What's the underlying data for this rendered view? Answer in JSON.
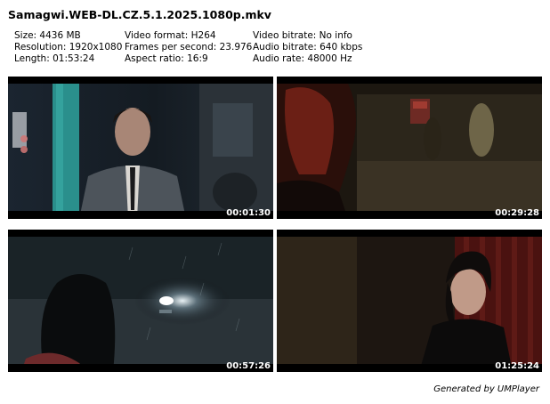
{
  "title": "Samagwi.WEB-DL.CZ.5.1.2025.1080p.mkv",
  "info": {
    "col1": [
      "Size: 4436 MB",
      "Resolution: 1920x1080",
      "Length: 01:53:24"
    ],
    "col2": [
      "Video format: H264",
      "Frames per second: 23.976",
      "Aspect ratio: 16:9"
    ],
    "col3": [
      "Video bitrate: No info",
      "Audio bitrate: 640 kbps",
      "Audio rate: 48000 Hz"
    ]
  },
  "thumbnails": [
    {
      "timestamp": "00:01:30"
    },
    {
      "timestamp": "00:29:28"
    },
    {
      "timestamp": "00:57:26"
    },
    {
      "timestamp": "01:25:24"
    }
  ],
  "footer": "Generated by UMPlayer"
}
